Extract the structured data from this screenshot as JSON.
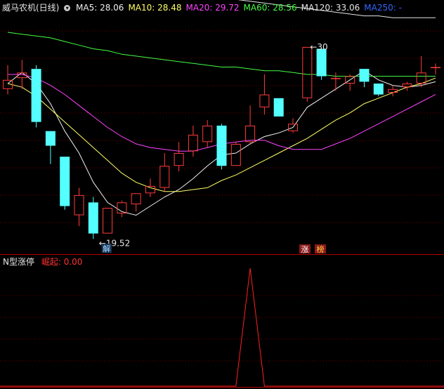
{
  "legend": {
    "title": "威马农机(日线)",
    "items": [
      {
        "label": "MA5:",
        "value": "28.06",
        "color": "#f0f0f0"
      },
      {
        "label": "MA10:",
        "value": "28.48",
        "color": "#ffff66"
      },
      {
        "label": "MA20:",
        "value": "29.72",
        "color": "#ff44ff"
      },
      {
        "label": "MA60:",
        "value": "28.56",
        "color": "#44ff44"
      },
      {
        "label": "MA120:",
        "value": "33.06",
        "color": "#e6e6e6"
      },
      {
        "label": "MA250:",
        "value": "-",
        "color": "#3366ff"
      }
    ]
  },
  "indicator": {
    "name": "N型涨停",
    "label": "崛起:",
    "value": "0.00"
  },
  "annotations": {
    "high_label": "30",
    "low_label": "19.52",
    "low_badge": "解",
    "badge_zhang": "涨",
    "badge_bang": "榜"
  },
  "colors": {
    "up": "#ff3c3c",
    "down": "#54ffff",
    "background": "#000000",
    "grid": "#7a0000",
    "separator": "#b40000"
  },
  "chart_data": {
    "type": "candlestick",
    "price_range": [
      18.9,
      31.8
    ],
    "candles": [
      {
        "o": 27.7,
        "c": 28.2,
        "h": 29.0,
        "l": 27.4
      },
      {
        "o": 28.3,
        "c": 28.6,
        "h": 29.3,
        "l": 27.7
      },
      {
        "o": 28.8,
        "c": 25.9,
        "h": 29.0,
        "l": 25.6
      },
      {
        "o": 25.4,
        "c": 24.6,
        "h": 25.4,
        "l": 23.6
      },
      {
        "o": 24.0,
        "c": 21.3,
        "h": 24.0,
        "l": 21.1
      },
      {
        "o": 20.8,
        "c": 21.9,
        "h": 22.3,
        "l": 20.2
      },
      {
        "o": 21.5,
        "c": 19.8,
        "h": 21.8,
        "l": 19.5
      },
      {
        "o": 19.8,
        "c": 21.2,
        "h": 21.2,
        "l": 19.8
      },
      {
        "o": 20.9,
        "c": 21.5,
        "h": 21.6,
        "l": 20.7
      },
      {
        "o": 21.4,
        "c": 22.0,
        "h": 22.0,
        "l": 21.0
      },
      {
        "o": 22.0,
        "c": 22.4,
        "h": 22.8,
        "l": 21.8
      },
      {
        "o": 22.3,
        "c": 23.5,
        "h": 24.2,
        "l": 22.1
      },
      {
        "o": 23.5,
        "c": 24.2,
        "h": 24.8,
        "l": 23.2
      },
      {
        "o": 24.3,
        "c": 25.2,
        "h": 25.7,
        "l": 24.0
      },
      {
        "o": 24.8,
        "c": 25.7,
        "h": 26.0,
        "l": 24.5
      },
      {
        "o": 25.7,
        "c": 23.5,
        "h": 25.8,
        "l": 23.3
      },
      {
        "o": 23.5,
        "c": 24.7,
        "h": 24.8,
        "l": 23.5
      },
      {
        "o": 24.8,
        "c": 25.7,
        "h": 26.8,
        "l": 24.7
      },
      {
        "o": 26.7,
        "c": 27.4,
        "h": 28.5,
        "l": 26.3
      },
      {
        "o": 27.2,
        "c": 26.2,
        "h": 27.2,
        "l": 26.2
      },
      {
        "o": 25.4,
        "c": 25.8,
        "h": 26.1,
        "l": 25.3
      },
      {
        "o": 27.2,
        "c": 30.0,
        "h": 30.0,
        "l": 27.0
      },
      {
        "o": 29.9,
        "c": 28.4,
        "h": 29.9,
        "l": 28.2
      },
      {
        "o": 28.3,
        "c": 28.3,
        "h": 28.6,
        "l": 27.6
      },
      {
        "o": 28.0,
        "c": 28.4,
        "h": 28.5,
        "l": 27.6
      },
      {
        "o": 28.8,
        "c": 28.1,
        "h": 28.8,
        "l": 27.8
      },
      {
        "o": 28.0,
        "c": 27.4,
        "h": 28.0,
        "l": 27.3
      },
      {
        "o": 27.5,
        "c": 27.7,
        "h": 27.9,
        "l": 27.3
      },
      {
        "o": 27.8,
        "c": 28.0,
        "h": 28.1,
        "l": 27.6
      },
      {
        "o": 28.0,
        "c": 28.6,
        "h": 29.5,
        "l": 27.8
      },
      {
        "o": 28.9,
        "c": 28.9,
        "h": 29.1,
        "l": 28.5
      }
    ],
    "ma5": [
      28.0,
      28.6,
      28.0,
      26.9,
      25.4,
      24.2,
      22.6,
      21.5,
      21.0,
      20.8,
      21.3,
      21.8,
      22.2,
      22.8,
      23.5,
      24.1,
      24.2,
      24.7,
      25.1,
      25.3,
      25.6,
      26.7,
      27.2,
      27.7,
      28.2,
      28.7,
      28.2,
      27.9,
      27.8,
      27.9,
      28.1
    ],
    "ma10": [
      28.0,
      27.8,
      27.3,
      26.6,
      25.9,
      25.2,
      24.5,
      23.8,
      23.1,
      22.6,
      22.3,
      22.1,
      22.1,
      22.2,
      22.3,
      22.7,
      23.0,
      23.4,
      23.8,
      24.2,
      24.6,
      25.0,
      25.5,
      26.0,
      26.4,
      26.9,
      27.2,
      27.5,
      27.8,
      28.0,
      28.3
    ],
    "ma20": [
      28.5,
      28.5,
      28.3,
      27.9,
      27.4,
      26.8,
      26.2,
      25.6,
      25.1,
      24.7,
      24.5,
      24.4,
      24.3,
      24.3,
      24.5,
      24.7,
      24.8,
      24.9,
      24.9,
      24.6,
      24.4,
      24.4,
      24.4,
      24.7,
      25.0,
      25.4,
      25.8,
      26.2,
      26.6,
      27.0,
      27.4
    ],
    "ma60": [
      30.8,
      30.7,
      30.6,
      30.5,
      30.3,
      30.1,
      29.9,
      29.8,
      29.6,
      29.5,
      29.4,
      29.3,
      29.2,
      29.1,
      29.0,
      28.9,
      28.9,
      28.8,
      28.7,
      28.7,
      28.6,
      28.5,
      28.5,
      28.4,
      28.4,
      28.4,
      28.4,
      28.4,
      28.4,
      28.4,
      28.4
    ],
    "ma120": [
      35.0,
      34.9,
      34.7,
      34.5,
      34.3,
      34.1,
      33.9,
      33.7,
      33.5,
      33.3,
      33.2,
      33.1,
      33.0,
      32.9,
      32.8,
      32.7,
      32.6,
      32.5,
      32.4,
      32.3,
      32.2,
      32.1,
      32.0,
      31.9,
      31.8,
      31.7,
      31.7,
      31.6,
      31.6,
      31.6,
      31.6
    ],
    "high_index": 21,
    "low_index": 6,
    "indicator": {
      "name": "N型涨停",
      "range": [
        0,
        1
      ],
      "values": [
        0,
        0,
        0,
        0,
        0,
        0,
        0,
        0,
        0,
        0,
        0,
        0,
        0,
        0,
        0,
        0,
        0,
        1,
        0,
        0,
        0,
        0,
        0,
        0,
        0,
        0,
        0,
        0,
        0,
        0,
        0
      ]
    }
  }
}
